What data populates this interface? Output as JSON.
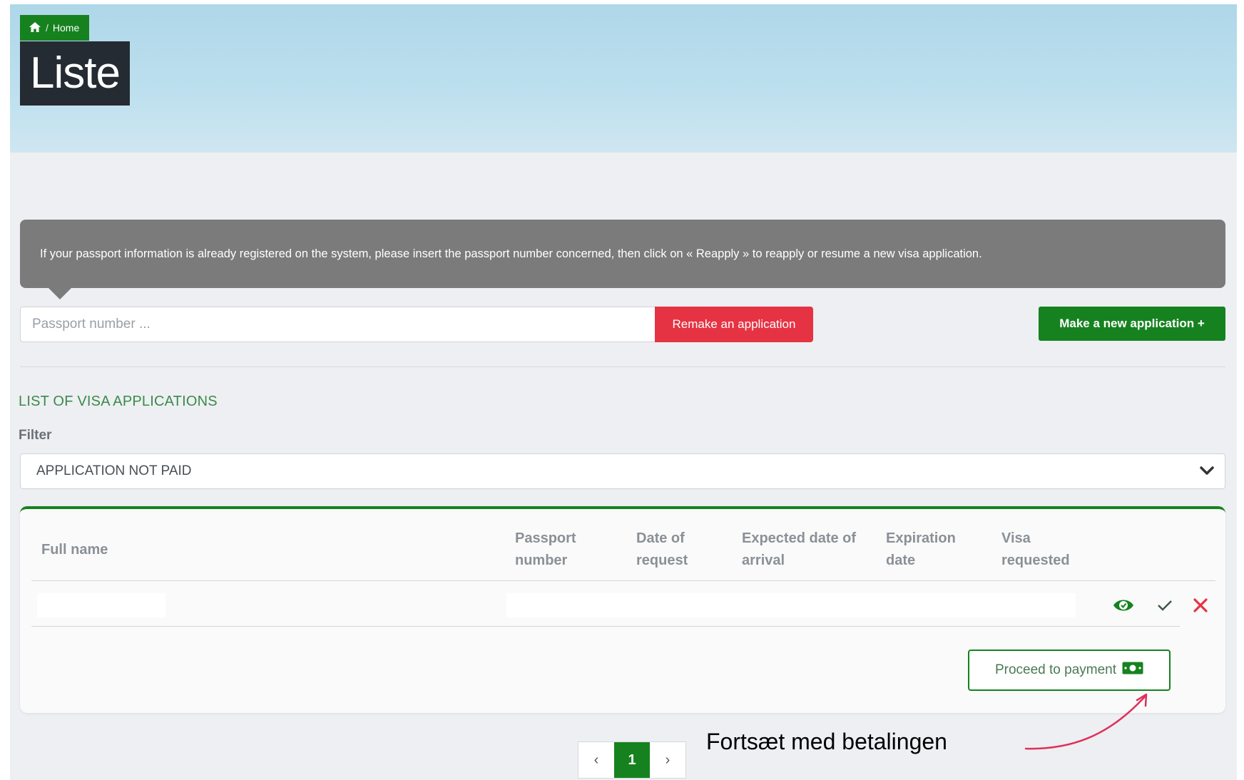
{
  "breadcrumb": {
    "home_label": "Home",
    "separator": "/"
  },
  "header": {
    "title": "Liste"
  },
  "info": {
    "text": "If your passport information is already registered on the system, please insert the passport number concerned, then click on « Reapply » to reapply or resume a new visa application."
  },
  "search": {
    "placeholder": "Passport number ..."
  },
  "buttons": {
    "remake": "Remake an application",
    "new_application": "Make a new application +",
    "proceed_payment": "Proceed to payment"
  },
  "section": {
    "title": "LIST OF VISA APPLICATIONS",
    "filter_label": "Filter",
    "filter_value": "APPLICATION NOT PAID"
  },
  "table": {
    "headers": {
      "full_name": "Full name",
      "passport_1": "Passport",
      "passport_2": "number",
      "date_request_1": "Date of",
      "date_request_2": "request",
      "arrival_1": "Expected date of",
      "arrival_2": "arrival",
      "expiration_1": "Expiration",
      "expiration_2": "date",
      "visa_1": "Visa",
      "visa_2": "requested"
    }
  },
  "pagination": {
    "current": "1",
    "prev": "‹",
    "next": "›"
  },
  "annotation": {
    "text": "Fortsæt med betalingen"
  },
  "colors": {
    "green": "#16821f",
    "red": "#e63343",
    "dark": "#242b33",
    "info_bg": "#7b7b7b",
    "annotation_arrow": "#e0305a"
  }
}
